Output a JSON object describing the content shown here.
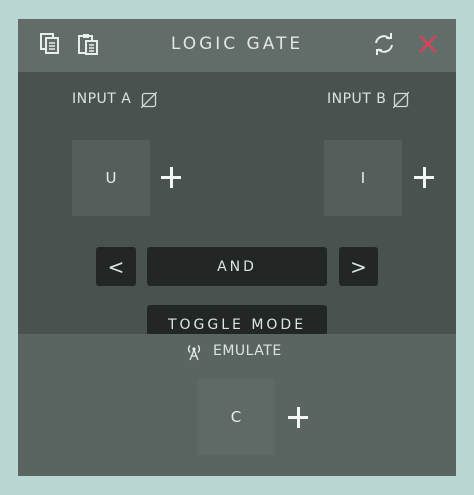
{
  "header": {
    "title": "LOGIC GATE",
    "icons": {
      "copy": "copy-icon",
      "paste": "paste-icon",
      "refresh": "refresh-icon",
      "close": "close-icon"
    },
    "close_color": "#d8435a"
  },
  "inputs": {
    "a": {
      "label": "INPUT A",
      "value": "U"
    },
    "b": {
      "label": "INPUT B",
      "value": "I"
    }
  },
  "gate": {
    "prev_label": "<",
    "mode_label": "AND",
    "next_label": ">",
    "toggle_label": "TOGGLE MODE"
  },
  "emulate": {
    "label": "EMULATE",
    "value": "C"
  }
}
